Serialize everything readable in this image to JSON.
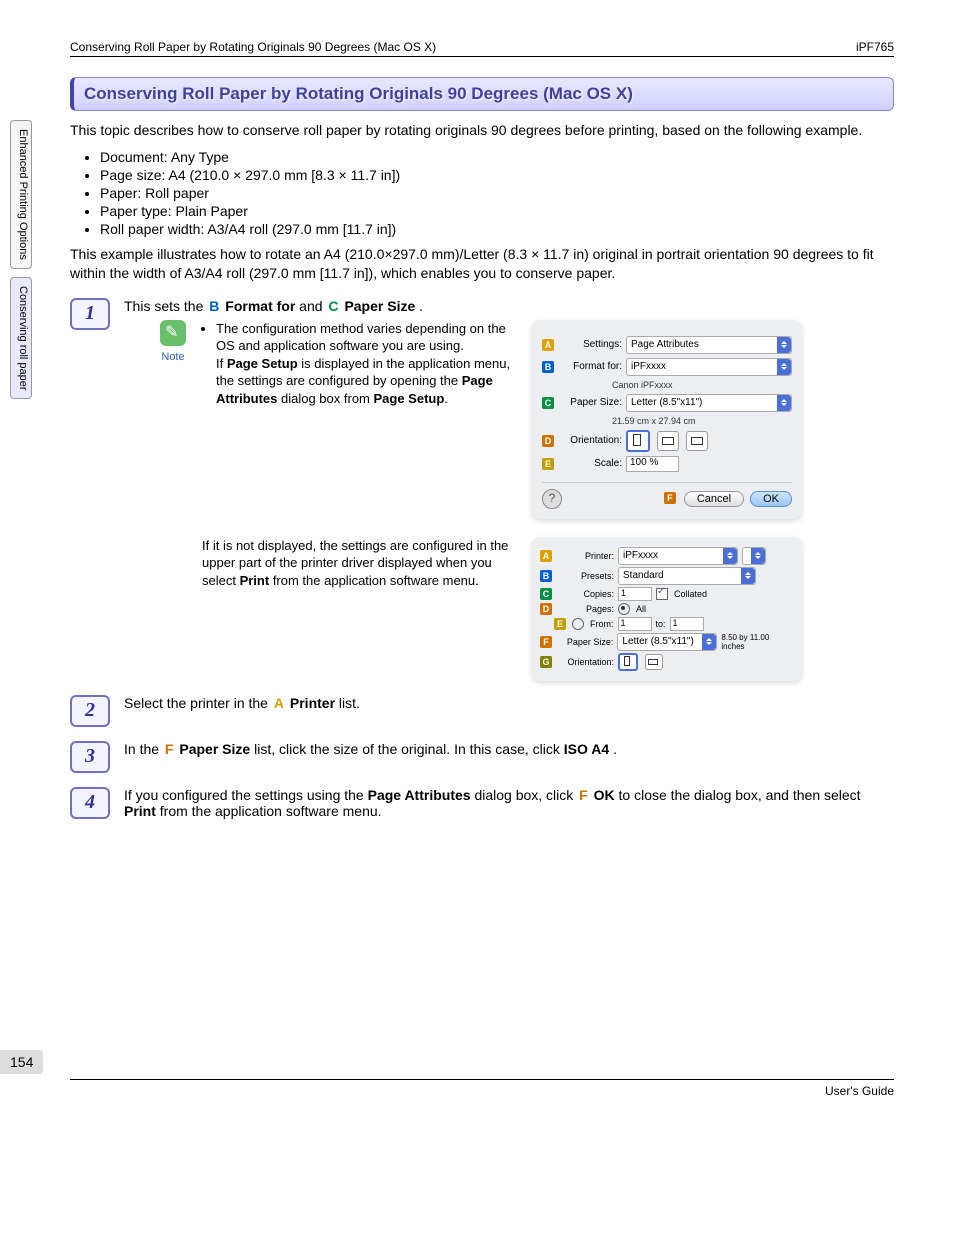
{
  "header": {
    "left": "Conserving Roll Paper by Rotating Originals 90 Degrees (Mac OS X)",
    "right": "iPF765"
  },
  "sideTabs": {
    "tab1": "Enhanced Printing Options",
    "tab2": "Conserving roll paper"
  },
  "sectionTitle": "Conserving Roll Paper by Rotating Originals 90 Degrees (Mac OS X)",
  "intro": "This topic describes how to conserve roll paper by rotating originals 90 degrees before printing, based on the following example.",
  "bullets": {
    "b1": "Document: Any Type",
    "b2": "Page size: A4 (210.0 × 297.0 mm [8.3 × 11.7 in])",
    "b3": "Paper: Roll paper",
    "b4": "Paper type: Plain Paper",
    "b5": "Roll paper width: A3/A4 roll (297.0 mm [11.7 in])"
  },
  "intro2": "This example illustrates how to rotate an A4 (210.0×297.0 mm)/Letter (8.3 × 11.7 in) original in portrait orientation 90 degrees to fit within the width of A3/A4 roll (297.0 mm [11.7 in]), which enables you to conserve paper.",
  "steps": {
    "s1": {
      "num": "1",
      "pre": "This sets the ",
      "B_lbl": "B",
      "B_txt": "Format for",
      "mid": " and ",
      "C_lbl": "C",
      "C_txt": "Paper Size",
      "post": "."
    },
    "note": {
      "label": "Note",
      "text_a": "The configuration method varies depending on the OS and application software you are using.",
      "text_b1": "If ",
      "text_b_bold1": "Page Setup",
      "text_b2": " is displayed in the application menu, the settings are configured by opening the ",
      "text_b_bold2": "Page Attributes",
      "text_b3": " dialog box from ",
      "text_b_bold3": "Page Setup",
      "text_b4": "."
    },
    "note2": {
      "t1": "If it is not displayed, the settings are configured in the upper part of the printer driver displayed when you select ",
      "t_bold": "Print",
      "t2": " from the application software menu."
    },
    "s2": {
      "num": "2",
      "t1": "Select the printer in the ",
      "A_lbl": "A",
      "A_txt": "Printer",
      "t2": " list."
    },
    "s3": {
      "num": "3",
      "t1": "In the ",
      "F_lbl": "F",
      "F_txt": "Paper Size",
      "t2": " list, click the size of the original. In this case, click ",
      "bold": "ISO A4",
      "t3": "."
    },
    "s4": {
      "num": "4",
      "t1": "If you configured the settings using the ",
      "bold1": "Page Attributes",
      "t2": " dialog box, click ",
      "F_lbl": "F",
      "F_txt": "OK",
      "t3": " to close the dialog box, and then select ",
      "bold2": "Print",
      "t4": " from the application software menu."
    }
  },
  "dialog1": {
    "settings_lbl": "Settings:",
    "settings_val": "Page Attributes",
    "format_lbl": "Format for:",
    "format_val": "iPFxxxx",
    "format_sub": "Canon iPFxxxx",
    "paper_lbl": "Paper Size:",
    "paper_val": "Letter (8.5\"x11\")",
    "paper_sub": "21.59 cm x 27.94 cm",
    "orient_lbl": "Orientation:",
    "scale_lbl": "Scale:",
    "scale_val": "100 %",
    "cancel": "Cancel",
    "ok": "OK",
    "A": "A",
    "B": "B",
    "C": "C",
    "D": "D",
    "E": "E",
    "F": "F"
  },
  "dialog2": {
    "printer_lbl": "Printer:",
    "printer_val": "iPFxxxx",
    "presets_lbl": "Presets:",
    "presets_val": "Standard",
    "copies_lbl": "Copies:",
    "copies_val": "1",
    "collated": "Collated",
    "pages_lbl": "Pages:",
    "all": "All",
    "from": "From:",
    "from_val": "1",
    "to": "to:",
    "to_val": "1",
    "paper_lbl": "Paper Size:",
    "paper_val": "Letter (8.5\"x11\")",
    "paper_dim": "8.50 by 11.00 inches",
    "orient_lbl": "Orientation:",
    "A": "A",
    "B": "B",
    "C": "C",
    "D": "D",
    "E": "E",
    "F": "F",
    "G": "G"
  },
  "pageNum": "154",
  "footer": "User's Guide"
}
